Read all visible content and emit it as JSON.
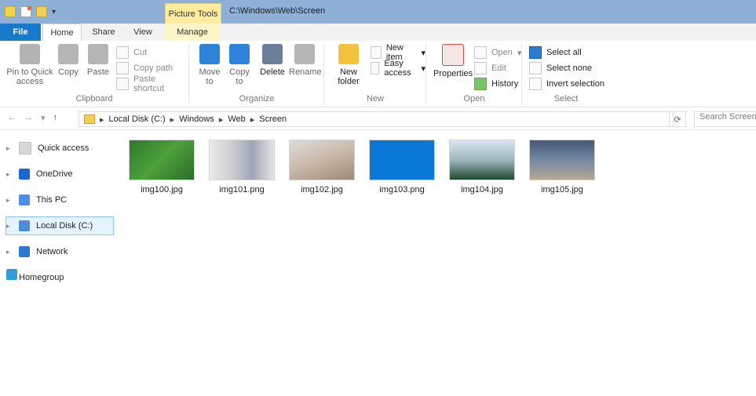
{
  "title_bar": {
    "context_tab": "Picture Tools",
    "path": "C:\\Windows\\Web\\Screen"
  },
  "tabs": [
    "File",
    "Home",
    "Share",
    "View",
    "Manage"
  ],
  "ribbon": {
    "clipboard": {
      "pin_label": "Pin to Quick access",
      "copy": "Copy",
      "paste": "Paste",
      "cut": "Cut",
      "copy_path": "Copy path",
      "paste_shortcut": "Paste shortcut",
      "group_label": "Clipboard"
    },
    "organize": {
      "move_to": "Move to",
      "copy_to": "Copy to",
      "delete": "Delete",
      "rename": "Rename",
      "group_label": "Organize"
    },
    "new": {
      "new_folder": "New folder",
      "new_item": "New item",
      "easy_access": "Easy access",
      "group_label": "New"
    },
    "open": {
      "properties": "Properties",
      "open": "Open",
      "edit": "Edit",
      "history": "History",
      "group_label": "Open"
    },
    "select": {
      "select_all": "Select all",
      "select_none": "Select none",
      "invert_selection": "Invert selection",
      "group_label": "Select"
    }
  },
  "address": {
    "breadcrumb": [
      "Local Disk (C:)",
      "Windows",
      "Web",
      "Screen"
    ],
    "search_placeholder": "Search Screen"
  },
  "nav_items": [
    {
      "label": "Quick access",
      "icon": "home-star-icon"
    },
    {
      "label": "OneDrive",
      "icon": "cloud-icon"
    },
    {
      "label": "This PC",
      "icon": "pc-icon"
    },
    {
      "label": "Local Disk (C:)",
      "icon": "disk-icon",
      "selected": true
    },
    {
      "label": "Network",
      "icon": "network-icon"
    },
    {
      "label": "Homegroup",
      "icon": "homegroup-icon"
    }
  ],
  "files": [
    {
      "name": "img100.jpg"
    },
    {
      "name": "img101.png"
    },
    {
      "name": "img102.jpg"
    },
    {
      "name": "img103.png"
    },
    {
      "name": "img104.jpg"
    },
    {
      "name": "img105.jpg"
    }
  ],
  "colors": {
    "file_tab": "#1979ca",
    "picture_tools_bg": "#ffec9e",
    "title_bar": "#8fb0d6",
    "selected_nav_bg": "#e5f3ff"
  }
}
